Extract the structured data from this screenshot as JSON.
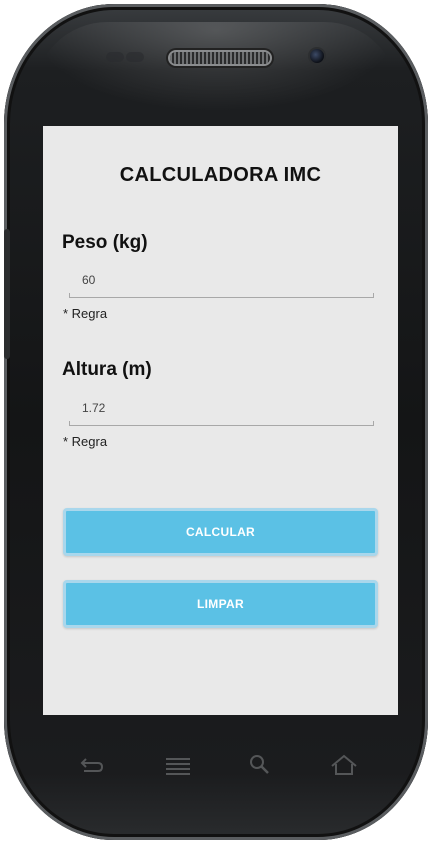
{
  "app": {
    "title": "CALCULADORA IMC"
  },
  "peso": {
    "label": "Peso (kg)",
    "value": "60",
    "hint": "* Regra"
  },
  "altura": {
    "label": "Altura (m)",
    "value": "1.72",
    "hint": "* Regra"
  },
  "buttons": {
    "calcular": "CALCULAR",
    "limpar": "LIMPAR"
  },
  "navbar": {
    "icons": [
      "back-icon",
      "menu-icon",
      "search-icon",
      "home-icon"
    ]
  },
  "colors": {
    "button": "#5bc1e5",
    "button_border": "#a9d7ec",
    "screen_bg": "#e9e9e9",
    "device_body": "#141516"
  }
}
